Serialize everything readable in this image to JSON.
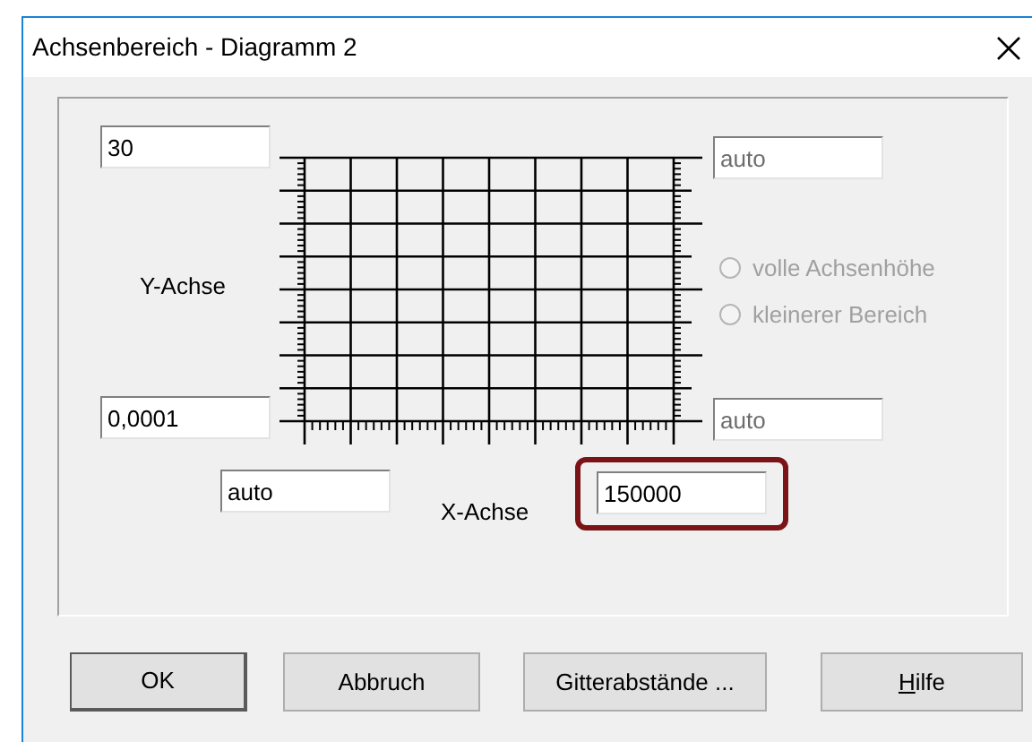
{
  "window": {
    "title": "Achsenbereich - Diagramm 2"
  },
  "y_axis": {
    "label": "Y-Achse",
    "max": {
      "value": "30",
      "disabled": false
    },
    "min": {
      "value": "0,0001",
      "disabled": false
    },
    "right_max": {
      "value": "auto",
      "disabled": true
    },
    "right_min": {
      "value": "auto",
      "disabled": true
    }
  },
  "radios": [
    {
      "label": "volle Achsenhöhe",
      "selected": false,
      "disabled": true
    },
    {
      "label": "kleinerer Bereich",
      "selected": false,
      "disabled": true
    }
  ],
  "x_axis": {
    "label": "X-Achse",
    "min": {
      "value": "auto",
      "disabled": false
    },
    "max": {
      "value": "150000",
      "disabled": false,
      "highlighted": true
    }
  },
  "buttons": [
    {
      "label": "OK",
      "default": true
    },
    {
      "label": "Abbruch",
      "default": false
    },
    {
      "label": "Gitterabstände ...",
      "default": false
    },
    {
      "label": "Hilfe",
      "default": false,
      "underline_first_letter": true
    }
  ]
}
